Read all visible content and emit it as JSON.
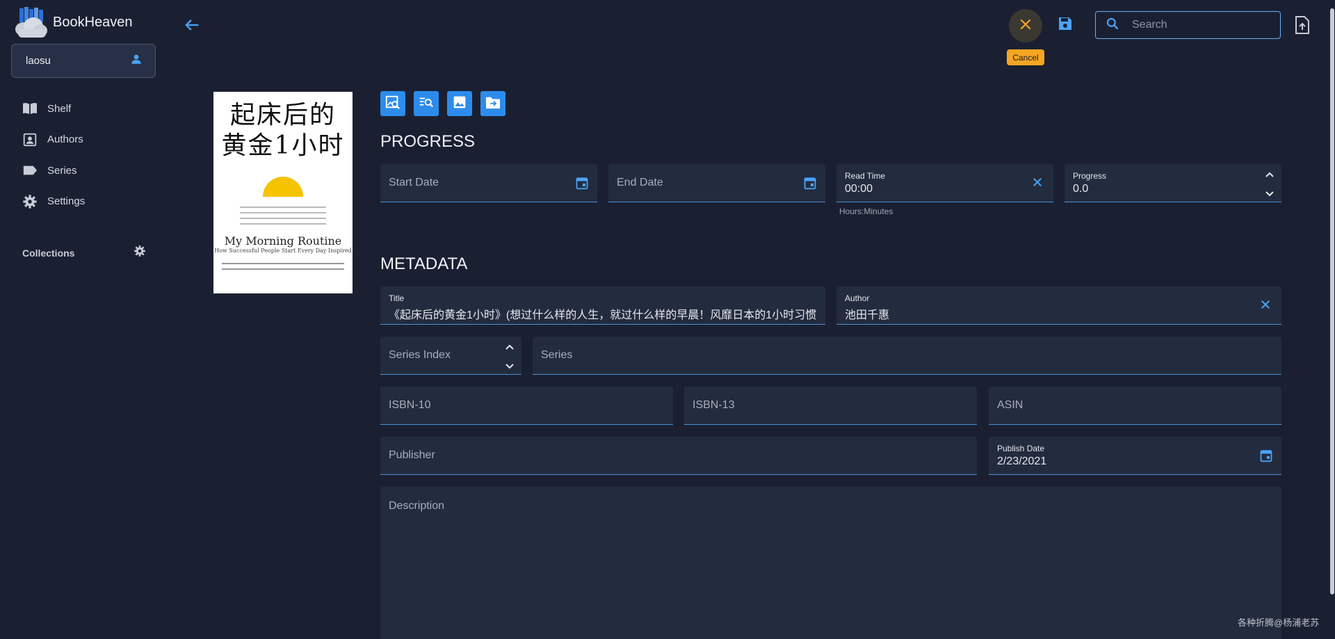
{
  "app": {
    "title": "BookHeaven"
  },
  "user": {
    "name": "laosu"
  },
  "sidebar": {
    "items": [
      {
        "label": "Shelf",
        "icon": "book-open-icon"
      },
      {
        "label": "Authors",
        "icon": "contact-card-icon"
      },
      {
        "label": "Series",
        "icon": "label-tag-icon"
      },
      {
        "label": "Settings",
        "icon": "gear-icon"
      }
    ],
    "collections_label": "Collections"
  },
  "topbar": {
    "cancel_tooltip": "Cancel",
    "search_placeholder": "Search",
    "accent_color": "#f5a623",
    "primary_color": "#2d8ceb"
  },
  "cover": {
    "title_cn_line1": "起床后的",
    "title_cn_line2": "黄金1小时",
    "title_en": "My Morning Routine",
    "subtitle_en": "How Successful People Start Every Day Inspired"
  },
  "progress": {
    "heading": "PROGRESS",
    "start_date_placeholder": "Start Date",
    "end_date_placeholder": "End Date",
    "read_time_label": "Read Time",
    "read_time_value": "00:00",
    "read_time_hint": "Hours:Minutes",
    "progress_label": "Progress",
    "progress_value": "0.0"
  },
  "metadata": {
    "heading": "METADATA",
    "title_label": "Title",
    "title_value": "《起床后的黄金1小时》(想过什么样的人生，就过什么样的早晨！风靡日本的1小时习惯",
    "author_label": "Author",
    "author_value": "池田千惠",
    "series_index_placeholder": "Series Index",
    "series_placeholder": "Series",
    "isbn10_placeholder": "ISBN-10",
    "isbn13_placeholder": "ISBN-13",
    "asin_placeholder": "ASIN",
    "publisher_placeholder": "Publisher",
    "publish_date_label": "Publish Date",
    "publish_date_value": "2/23/2021",
    "description_placeholder": "Description"
  },
  "watermark": "各种折腾@杨浦老苏"
}
